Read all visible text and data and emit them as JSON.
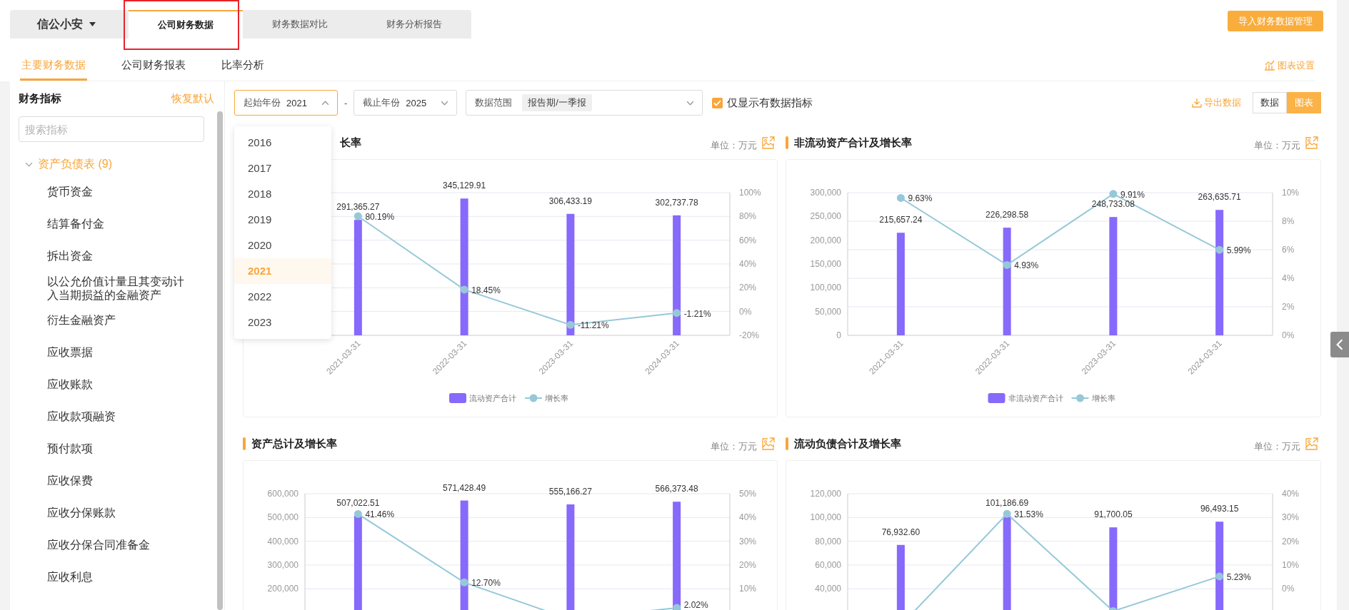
{
  "top_tabs": {
    "brand": "信公小安",
    "tabs": [
      {
        "label": "公司财务数据",
        "selected": true,
        "highlighted": true
      },
      {
        "label": "财务数据对比",
        "selected": false,
        "highlighted": false
      },
      {
        "label": "财务分析报告",
        "selected": false,
        "highlighted": false
      }
    ],
    "import_button": "导入财务数据管理"
  },
  "sub_tabs": {
    "tabs": [
      {
        "label": "主要财务数据",
        "selected": true
      },
      {
        "label": "公司财务报表",
        "selected": false
      },
      {
        "label": "比率分析",
        "selected": false
      }
    ],
    "chart_settings": "图表设置"
  },
  "sidebar": {
    "title": "财务指标",
    "reset": "恢复默认",
    "search": {
      "placeholder": "搜索指标"
    },
    "tree": [
      {
        "label": "资产负债表 (9)",
        "expanded": true,
        "children": [
          {
            "label": "货币资金"
          },
          {
            "label": "结算备付金"
          },
          {
            "label": "拆出资金"
          },
          {
            "label": "以公允价值计量且其变动计入当期损益的金融资产"
          },
          {
            "label": "衍生金融资产"
          },
          {
            "label": "应收票据"
          },
          {
            "label": "应收账款"
          },
          {
            "label": "应收款项融资"
          },
          {
            "label": "预付款项"
          },
          {
            "label": "应收保费"
          },
          {
            "label": "应收分保账款"
          },
          {
            "label": "应收分保合同准备金"
          },
          {
            "label": "应收利息"
          }
        ]
      }
    ]
  },
  "filters": {
    "start_year": {
      "label": "起始年份",
      "value": "2021",
      "open": true,
      "options": [
        {
          "label": "2016",
          "selected": false
        },
        {
          "label": "2017",
          "selected": false
        },
        {
          "label": "2018",
          "selected": false
        },
        {
          "label": "2019",
          "selected": false
        },
        {
          "label": "2020",
          "selected": false
        },
        {
          "label": "2021",
          "selected": true
        },
        {
          "label": "2022",
          "selected": false
        },
        {
          "label": "2023",
          "selected": false
        }
      ]
    },
    "separator": "-",
    "end_year": {
      "label": "截止年份",
      "value": "2025",
      "open": false
    },
    "data_range": {
      "label": "数据范围",
      "tags": [
        "报告期/一季报"
      ]
    },
    "only_with_data": {
      "label": "仅显示有数据指标",
      "checked": true
    },
    "export": "导出数据",
    "view_modes": [
      {
        "label": "数据",
        "selected": false
      },
      {
        "label": "图表",
        "selected": true
      }
    ]
  },
  "charts": [
    {
      "title": "长率",
      "unit": "单位：万元",
      "chart_data": {
        "type": "bar",
        "categories": [
          "2021-03-31",
          "2022-03-31",
          "2023-03-31",
          "2024-03-31"
        ],
        "series": [
          {
            "name": "流动资产合计",
            "type": "bar",
            "color": "#8769fc",
            "values": [
              291365.27,
              345129.91,
              306433.19,
              302737.78
            ],
            "value_labels": [
              "291,365.27",
              "345,129.91",
              "306,433.19",
              "302,737.78"
            ]
          },
          {
            "name": "增长率",
            "type": "line",
            "marker": "circle",
            "axis": "y2",
            "color": "#96c8d8",
            "values": [
              80.19,
              18.45,
              -11.21,
              -1.21
            ],
            "value_labels": [
              "80.19%",
              "18.45%",
              "-11.21%",
              "-1.21%"
            ]
          }
        ],
        "grid": true,
        "legend": "bottom",
        "ylim": [
          0,
          360000
        ],
        "y2lim": [
          -20,
          100
        ],
        "y2ticks": [
          {
            "value": -20,
            "label": "-20%"
          },
          {
            "value": 0,
            "label": "0%"
          },
          {
            "value": 20,
            "label": "20%"
          },
          {
            "value": 40,
            "label": "40%"
          },
          {
            "value": 60,
            "label": "60%"
          },
          {
            "value": 80,
            "label": "80%"
          },
          {
            "value": 100,
            "label": "100%"
          }
        ]
      }
    },
    {
      "title": "非流动资产合计及增长率",
      "unit": "单位：万元",
      "chart_data": {
        "type": "bar",
        "categories": [
          "2021-03-31",
          "2022-03-31",
          "2023-03-31",
          "2024-03-31"
        ],
        "series": [
          {
            "name": "非流动资产合计",
            "type": "bar",
            "color": "#8769fc",
            "values": [
              215657.24,
              226298.58,
              248733.08,
              263635.71
            ],
            "value_labels": [
              "215,657.24",
              "226,298.58",
              "248,733.08",
              "263,635.71"
            ]
          },
          {
            "name": "增长率",
            "type": "line",
            "marker": "circle",
            "axis": "y2",
            "color": "#96c8d8",
            "values": [
              9.63,
              4.93,
              9.91,
              5.99
            ],
            "value_labels": [
              "9.63%",
              "4.93%",
              "9.91%",
              "5.99%"
            ]
          }
        ],
        "grid": true,
        "legend": "bottom",
        "ylim": [
          0,
          300000
        ],
        "yticks": [
          {
            "value": 0,
            "label": "0"
          },
          {
            "value": 50000,
            "label": "50,000"
          },
          {
            "value": 100000,
            "label": "100,000"
          },
          {
            "value": 150000,
            "label": "150,000"
          },
          {
            "value": 200000,
            "label": "200,000"
          },
          {
            "value": 250000,
            "label": "250,000"
          },
          {
            "value": 300000,
            "label": "300,000"
          }
        ],
        "y2lim": [
          0,
          10
        ],
        "y2ticks": [
          {
            "value": 0,
            "label": "0%"
          },
          {
            "value": 2,
            "label": "2%"
          },
          {
            "value": 4,
            "label": "4%"
          },
          {
            "value": 6,
            "label": "6%"
          },
          {
            "value": 8,
            "label": "8%"
          },
          {
            "value": 10,
            "label": "10%"
          }
        ]
      }
    },
    {
      "title": "资产总计及增长率",
      "unit": "单位：万元",
      "chart_data": {
        "type": "bar",
        "series": [
          {
            "type": "bar",
            "color": "#8769fc",
            "values": [
              507022.51,
              571428.49,
              555166.27,
              566373.48
            ],
            "value_labels": [
              "507,022.51",
              "571,428.49",
              "555,166.27",
              "566,373.48"
            ]
          },
          {
            "type": "line",
            "marker": "circle",
            "axis": "y2",
            "color": "#96c8d8",
            "values": [
              41.46,
              12.7,
              -2.85,
              2.02
            ],
            "value_labels": [
              "41.46%",
              "12.70%",
              null,
              "2.02%"
            ]
          }
        ],
        "grid": true,
        "ylim": [
          0,
          600000
        ],
        "yticks": [
          {
            "value": 200000,
            "label": "200,000"
          },
          {
            "value": 300000,
            "label": "300,000"
          },
          {
            "value": 400000,
            "label": "400,000"
          },
          {
            "value": 500000,
            "label": "500,000"
          },
          {
            "value": 600000,
            "label": "600,000"
          }
        ],
        "y2lim": [
          -10,
          50
        ],
        "y2ticks": [
          {
            "value": 10,
            "label": "10%"
          },
          {
            "value": 20,
            "label": "20%"
          },
          {
            "value": 30,
            "label": "30%"
          },
          {
            "value": 40,
            "label": "40%"
          },
          {
            "value": 50,
            "label": "50%"
          }
        ]
      }
    },
    {
      "title": "流动负债合计及增长率",
      "unit": "单位：万元",
      "chart_data": {
        "type": "bar",
        "series": [
          {
            "type": "bar",
            "color": "#8769fc",
            "values": [
              76932.6,
              101186.69,
              91700.05,
              96493.15
            ],
            "value_labels": [
              "76,932.60",
              "101,186.69",
              "91,700.05",
              "96,493.15"
            ]
          },
          {
            "type": "line",
            "marker": "circle",
            "axis": "y2",
            "color": "#96c8d8",
            "values": [
              -15.4,
              31.53,
              -9.38,
              5.23
            ],
            "value_labels": [
              null,
              "31.53%",
              null,
              "5.23%"
            ]
          }
        ],
        "grid": true,
        "ylim": [
          0,
          120000
        ],
        "yticks": [
          {
            "value": 40000,
            "label": "40,000"
          },
          {
            "value": 60000,
            "label": "60,000"
          },
          {
            "value": 80000,
            "label": "80,000"
          },
          {
            "value": 100000,
            "label": "100,000"
          },
          {
            "value": 120000,
            "label": "120,000"
          }
        ],
        "y2lim": [
          -20,
          40
        ],
        "y2ticks": [
          {
            "value": 0,
            "label": "0%"
          },
          {
            "value": 10,
            "label": "10%"
          },
          {
            "value": 20,
            "label": "20%"
          },
          {
            "value": 30,
            "label": "30%"
          },
          {
            "value": 40,
            "label": "40%"
          }
        ]
      }
    }
  ]
}
